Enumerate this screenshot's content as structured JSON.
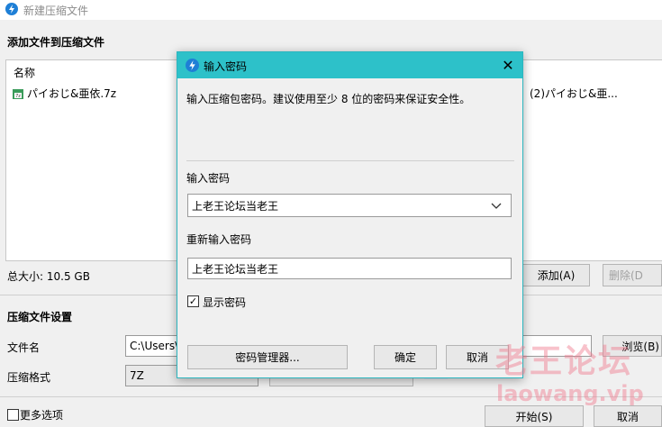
{
  "window": {
    "title": "新建压缩文件",
    "add_section_title": "添加文件到压缩文件",
    "list_header_name": "名称",
    "file_name": "パイおじ&亜依.7z",
    "file_path_right": "(2)パイおじ&亜...",
    "total_size": "总大小: 10.5 GB",
    "add_button": "添加(A)",
    "delete_button": "删除(D",
    "settings_title": "压缩文件设置",
    "filename_label": "文件名",
    "filename_value": "C:\\Users\\",
    "browse_button": "浏览(B)",
    "format_label": "压缩格式",
    "format_value": "7Z",
    "more_options": "更多选项",
    "start_button": "开始(S)",
    "cancel_button": "取消"
  },
  "dialog": {
    "title": "输入密码",
    "description": "输入压缩包密码。建议使用至少 8 位的密码来保证安全性。",
    "password_label": "输入密码",
    "password_value": "上老王论坛当老王",
    "reenter_label": "重新输入密码",
    "reenter_value": "上老王论坛当老王",
    "show_password_label": "显示密码",
    "show_password_checked": true,
    "manager_button": "密码管理器...",
    "ok_button": "确定",
    "cancel_button": "取消"
  },
  "watermark": {
    "text": "老王论坛",
    "url": "laowang.vip"
  },
  "colors": {
    "dialog_titlebar": "#2dc1c9",
    "accent": "#1e7fd6"
  }
}
